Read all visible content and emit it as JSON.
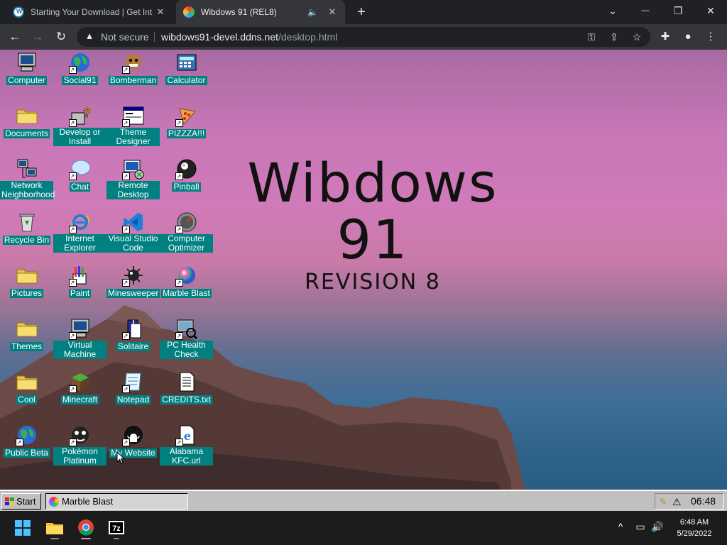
{
  "browser": {
    "tabs": [
      {
        "title": "Starting Your Download | Get Int",
        "active": false,
        "close": "✕"
      },
      {
        "title": "Wibdows 91 (REL8)",
        "active": true,
        "close": "✕"
      }
    ],
    "new_tab": "+",
    "window_controls": {
      "tab_search": "⌄",
      "minimize": "—",
      "maximize": "❐",
      "close": "✕"
    },
    "nav": {
      "back": "←",
      "forward": "→",
      "reload": "↻"
    },
    "address": {
      "security_label": "Not secure",
      "host": "wibdows91-devel.ddns.net",
      "path": "/desktop.html"
    }
  },
  "desktop": {
    "brand_title": "Wibdows 91",
    "brand_subtitle": "REVISION 8",
    "icons": [
      {
        "label": "Computer",
        "icon": "computer-icon",
        "shortcut": false
      },
      {
        "label": "Social91",
        "icon": "globe-icon",
        "shortcut": true
      },
      {
        "label": "Bomberman",
        "icon": "bomberman-icon",
        "shortcut": true
      },
      {
        "label": "Calculator",
        "icon": "calculator-icon",
        "shortcut": false
      },
      {
        "label": "Documents",
        "icon": "folder-icon",
        "shortcut": false
      },
      {
        "label": "Develop or Install",
        "icon": "help-icon",
        "shortcut": true
      },
      {
        "label": "Theme Designer",
        "icon": "window-icon",
        "shortcut": true
      },
      {
        "label": "PIZZZA!!!",
        "icon": "pizza-icon",
        "shortcut": true
      },
      {
        "label": "Network Neighborhood",
        "icon": "network-icon",
        "shortcut": false
      },
      {
        "label": "Chat",
        "icon": "chat-bubble-icon",
        "shortcut": true
      },
      {
        "label": "Remote Desktop",
        "icon": "remote-desktop-icon",
        "shortcut": true
      },
      {
        "label": "Pinball",
        "icon": "pinball-icon",
        "shortcut": true
      },
      {
        "label": "Recycle Bin",
        "icon": "recycle-bin-icon",
        "shortcut": false
      },
      {
        "label": "Internet Explorer",
        "icon": "internet-explorer-icon",
        "shortcut": true
      },
      {
        "label": "Visual Studio Code",
        "icon": "vscode-icon",
        "shortcut": true
      },
      {
        "label": "Computer Optimizer",
        "icon": "gauge-icon",
        "shortcut": true
      },
      {
        "label": "Pictures",
        "icon": "folder-icon",
        "shortcut": false
      },
      {
        "label": "Paint",
        "icon": "paint-icon",
        "shortcut": true
      },
      {
        "label": "Minesweeper",
        "icon": "mine-icon",
        "shortcut": true
      },
      {
        "label": "Marble Blast",
        "icon": "marble-icon",
        "shortcut": true
      },
      {
        "label": "Themes",
        "icon": "folder-icon",
        "shortcut": false
      },
      {
        "label": "Virtual Machine",
        "icon": "computer-icon",
        "shortcut": true
      },
      {
        "label": "Solitaire",
        "icon": "cards-icon",
        "shortcut": true
      },
      {
        "label": "PC Health Check",
        "icon": "health-check-icon",
        "shortcut": true
      },
      {
        "label": "Cool",
        "icon": "folder-icon",
        "shortcut": false
      },
      {
        "label": "Minecraft",
        "icon": "minecraft-icon",
        "shortcut": true
      },
      {
        "label": "Notepad",
        "icon": "notepad-icon",
        "shortcut": true
      },
      {
        "label": "CREDITS.txt",
        "icon": "text-file-icon",
        "shortcut": false
      },
      {
        "label": "Public Beta",
        "icon": "globe-icon",
        "shortcut": true
      },
      {
        "label": "Pokémon Platinum",
        "icon": "pokemon-icon",
        "shortcut": true
      },
      {
        "label": "My Website",
        "icon": "github-icon",
        "shortcut": true
      },
      {
        "label": "Alabama KFC.url",
        "icon": "ie-link-icon",
        "shortcut": true
      }
    ],
    "taskbar": {
      "start_label": "Start",
      "task_label": "Marble Blast",
      "tray_time": "06:48"
    }
  },
  "os_taskbar": {
    "apps": [
      "windows-start-icon",
      "file-explorer-icon",
      "chrome-icon",
      "7zip-icon"
    ],
    "tray_chevron": "^",
    "time": "6:48 AM",
    "date": "5/29/2022"
  },
  "colors": {
    "label_bg": "#008080",
    "chrome_dark": "#202124",
    "chrome_toolbar": "#35363a"
  }
}
